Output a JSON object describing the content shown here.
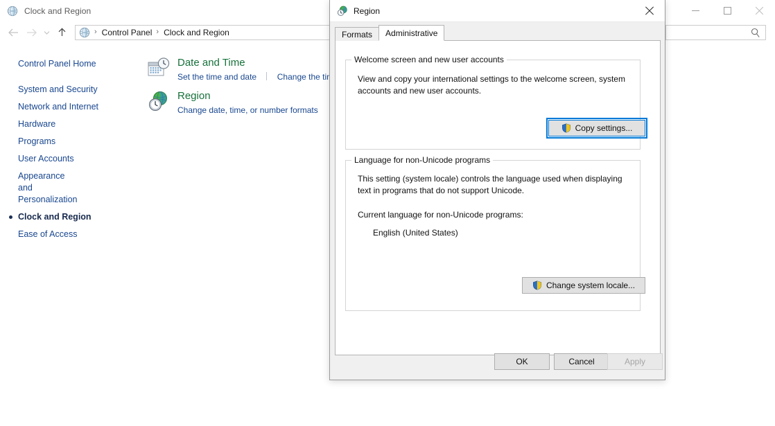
{
  "window": {
    "title": "Clock and Region",
    "icon": "clock-region-icon",
    "controls": {
      "minimize": "minimize-icon",
      "maximize": "maximize-icon",
      "close": "close-icon"
    }
  },
  "navbar": {
    "back": "back-arrow-icon",
    "forward": "forward-arrow-icon",
    "recent": "recent-locations-icon",
    "up": "up-arrow-icon",
    "breadcrumb": {
      "icon": "control-panel-icon",
      "separator": "›",
      "crumbs": [
        "Control Panel",
        "Clock and Region"
      ]
    },
    "search": {
      "value": "",
      "placeholder": "",
      "icon": "search-icon"
    }
  },
  "sidebar": {
    "home_label": "Control Panel Home",
    "items": [
      {
        "label": "System and Security",
        "current": false
      },
      {
        "label": "Network and Internet",
        "current": false
      },
      {
        "label": "Hardware",
        "current": false
      },
      {
        "label": "Programs",
        "current": false
      },
      {
        "label": "User Accounts",
        "current": false
      },
      {
        "label": "Appearance and Personalization",
        "current": false
      },
      {
        "label": "Clock and Region",
        "current": true
      },
      {
        "label": "Ease of Access",
        "current": false
      }
    ]
  },
  "content": {
    "entries": [
      {
        "icon": "date-time-icon",
        "title": "Date and Time",
        "links": [
          "Set the time and date",
          "Change the tim"
        ]
      },
      {
        "icon": "region-globe-clock-icon",
        "title": "Region",
        "links": [
          "Change date, time, or number formats"
        ]
      }
    ]
  },
  "dialog": {
    "title": "Region",
    "icon": "region-icon",
    "close_icon": "close-icon",
    "tabs": [
      {
        "label": "Formats",
        "active": false
      },
      {
        "label": "Administrative",
        "active": true
      }
    ],
    "welcome_group": {
      "title": "Welcome screen and new user accounts",
      "description": "View and copy your international settings to the welcome screen, system accounts and new user accounts.",
      "button": {
        "label": "Copy settings...",
        "icon": "uac-shield-icon",
        "focused": true
      }
    },
    "language_group": {
      "title": "Language for non-Unicode programs",
      "description": "This setting (system locale) controls the language used when displaying text in programs that do not support Unicode.",
      "current_label": "Current language for non-Unicode programs:",
      "current_value": "English (United States)",
      "button": {
        "label": "Change system locale...",
        "icon": "uac-shield-icon",
        "focused": false
      }
    },
    "footer": {
      "ok": "OK",
      "cancel": "Cancel",
      "apply": "Apply"
    }
  },
  "colors": {
    "accent_focus": "#0078d7",
    "link": "#19478f",
    "heading_green": "#16713a",
    "dialog_face": "#f0f0f0",
    "button_face": "#e1e1e1"
  }
}
